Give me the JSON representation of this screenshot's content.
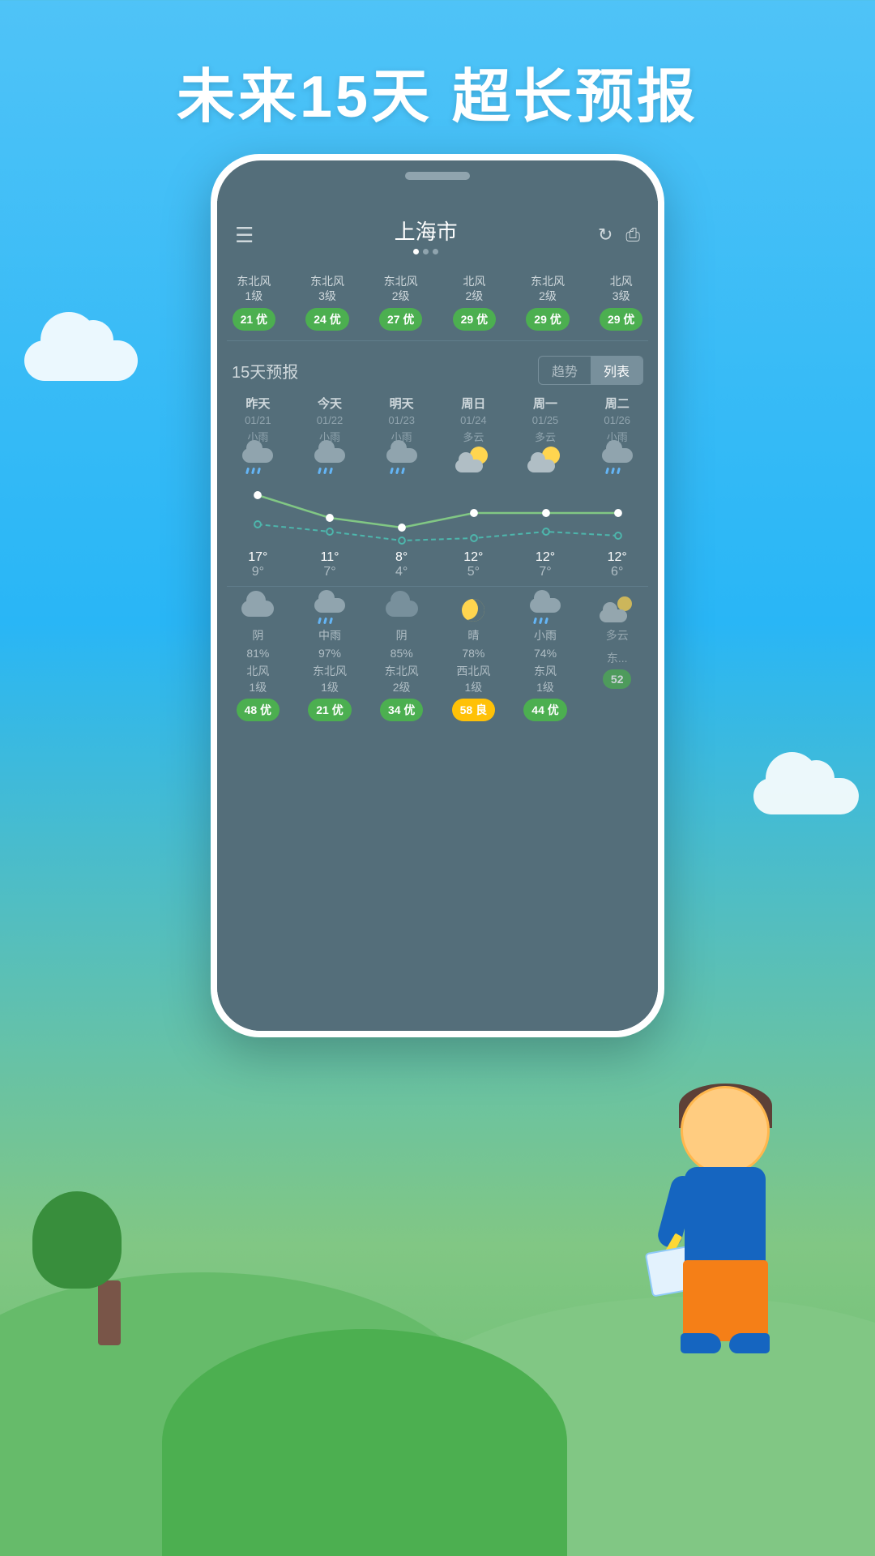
{
  "hero": {
    "title": "未来15天  超长预报"
  },
  "phone": {
    "header": {
      "city": "上海市",
      "dots": [
        true,
        false,
        false
      ],
      "icons": [
        "menu",
        "crown",
        "refresh",
        "share"
      ]
    },
    "wind_row": [
      {
        "wind": "东北风\n1级",
        "aqi": "21 优",
        "aqi_type": "green"
      },
      {
        "wind": "东北风\n3级",
        "aqi": "24 优",
        "aqi_type": "green"
      },
      {
        "wind": "东北风\n2级",
        "aqi": "27 优",
        "aqi_type": "green"
      },
      {
        "wind": "北风\n2级",
        "aqi": "29 优",
        "aqi_type": "green"
      },
      {
        "wind": "东北风\n2级",
        "aqi": "29 优",
        "aqi_type": "green"
      },
      {
        "wind": "北风\n3级",
        "aqi": "29 优",
        "aqi_type": "green"
      }
    ],
    "forecast_section": {
      "title": "15天预报",
      "tabs": [
        "趋势",
        "列表"
      ],
      "active_tab": "趋势"
    },
    "forecast_days": [
      {
        "day": "昨天",
        "date": "01/21",
        "condition": "小雨",
        "icon": "rain"
      },
      {
        "day": "今天",
        "date": "01/22",
        "condition": "小雨",
        "icon": "rain"
      },
      {
        "day": "明天",
        "date": "01/23",
        "condition": "小雨",
        "icon": "rain"
      },
      {
        "day": "周日",
        "date": "01/24",
        "condition": "多云",
        "icon": "pcloudy"
      },
      {
        "day": "周一",
        "date": "01/25",
        "condition": "多云",
        "icon": "pcloudy"
      },
      {
        "day": "周二",
        "date": "01/26",
        "condition": "小雨",
        "icon": "rain"
      }
    ],
    "temp_high": [
      "17°",
      "11°",
      "8°",
      "12°",
      "12°",
      "12°"
    ],
    "temp_low": [
      "9°",
      "7°",
      "4°",
      "5°",
      "7°",
      "6°"
    ],
    "graph": {
      "high_points": [
        78,
        50,
        38,
        56,
        56,
        56
      ],
      "low_points": [
        42,
        33,
        20,
        23,
        33,
        28
      ]
    },
    "bottom_days": [
      {
        "icon": "cloudy",
        "condition": "阴",
        "humidity": "81%",
        "wind": "北风\n1级",
        "aqi": "48 优",
        "aqi_type": "green"
      },
      {
        "icon": "rain_heavy",
        "condition": "中雨",
        "humidity": "97%",
        "wind": "东北风\n1级",
        "aqi": "21 优",
        "aqi_type": "green"
      },
      {
        "icon": "cloudy2",
        "condition": "阴",
        "humidity": "85%",
        "wind": "东北风\n2级",
        "aqi": "34 优",
        "aqi_type": "green"
      },
      {
        "icon": "moon",
        "condition": "晴",
        "humidity": "78%",
        "wind": "西北风\n1级",
        "aqi": "58 良",
        "aqi_type": "yellow"
      },
      {
        "icon": "rain_sm",
        "condition": "小雨",
        "humidity": "74%",
        "wind": "东风\n1级",
        "aqi": "44 优",
        "aqi_type": "green"
      },
      {
        "icon": "pcloudy2",
        "condition": "多云",
        "humidity": "",
        "wind": "东...",
        "aqi": "52",
        "aqi_type": "green"
      }
    ]
  }
}
